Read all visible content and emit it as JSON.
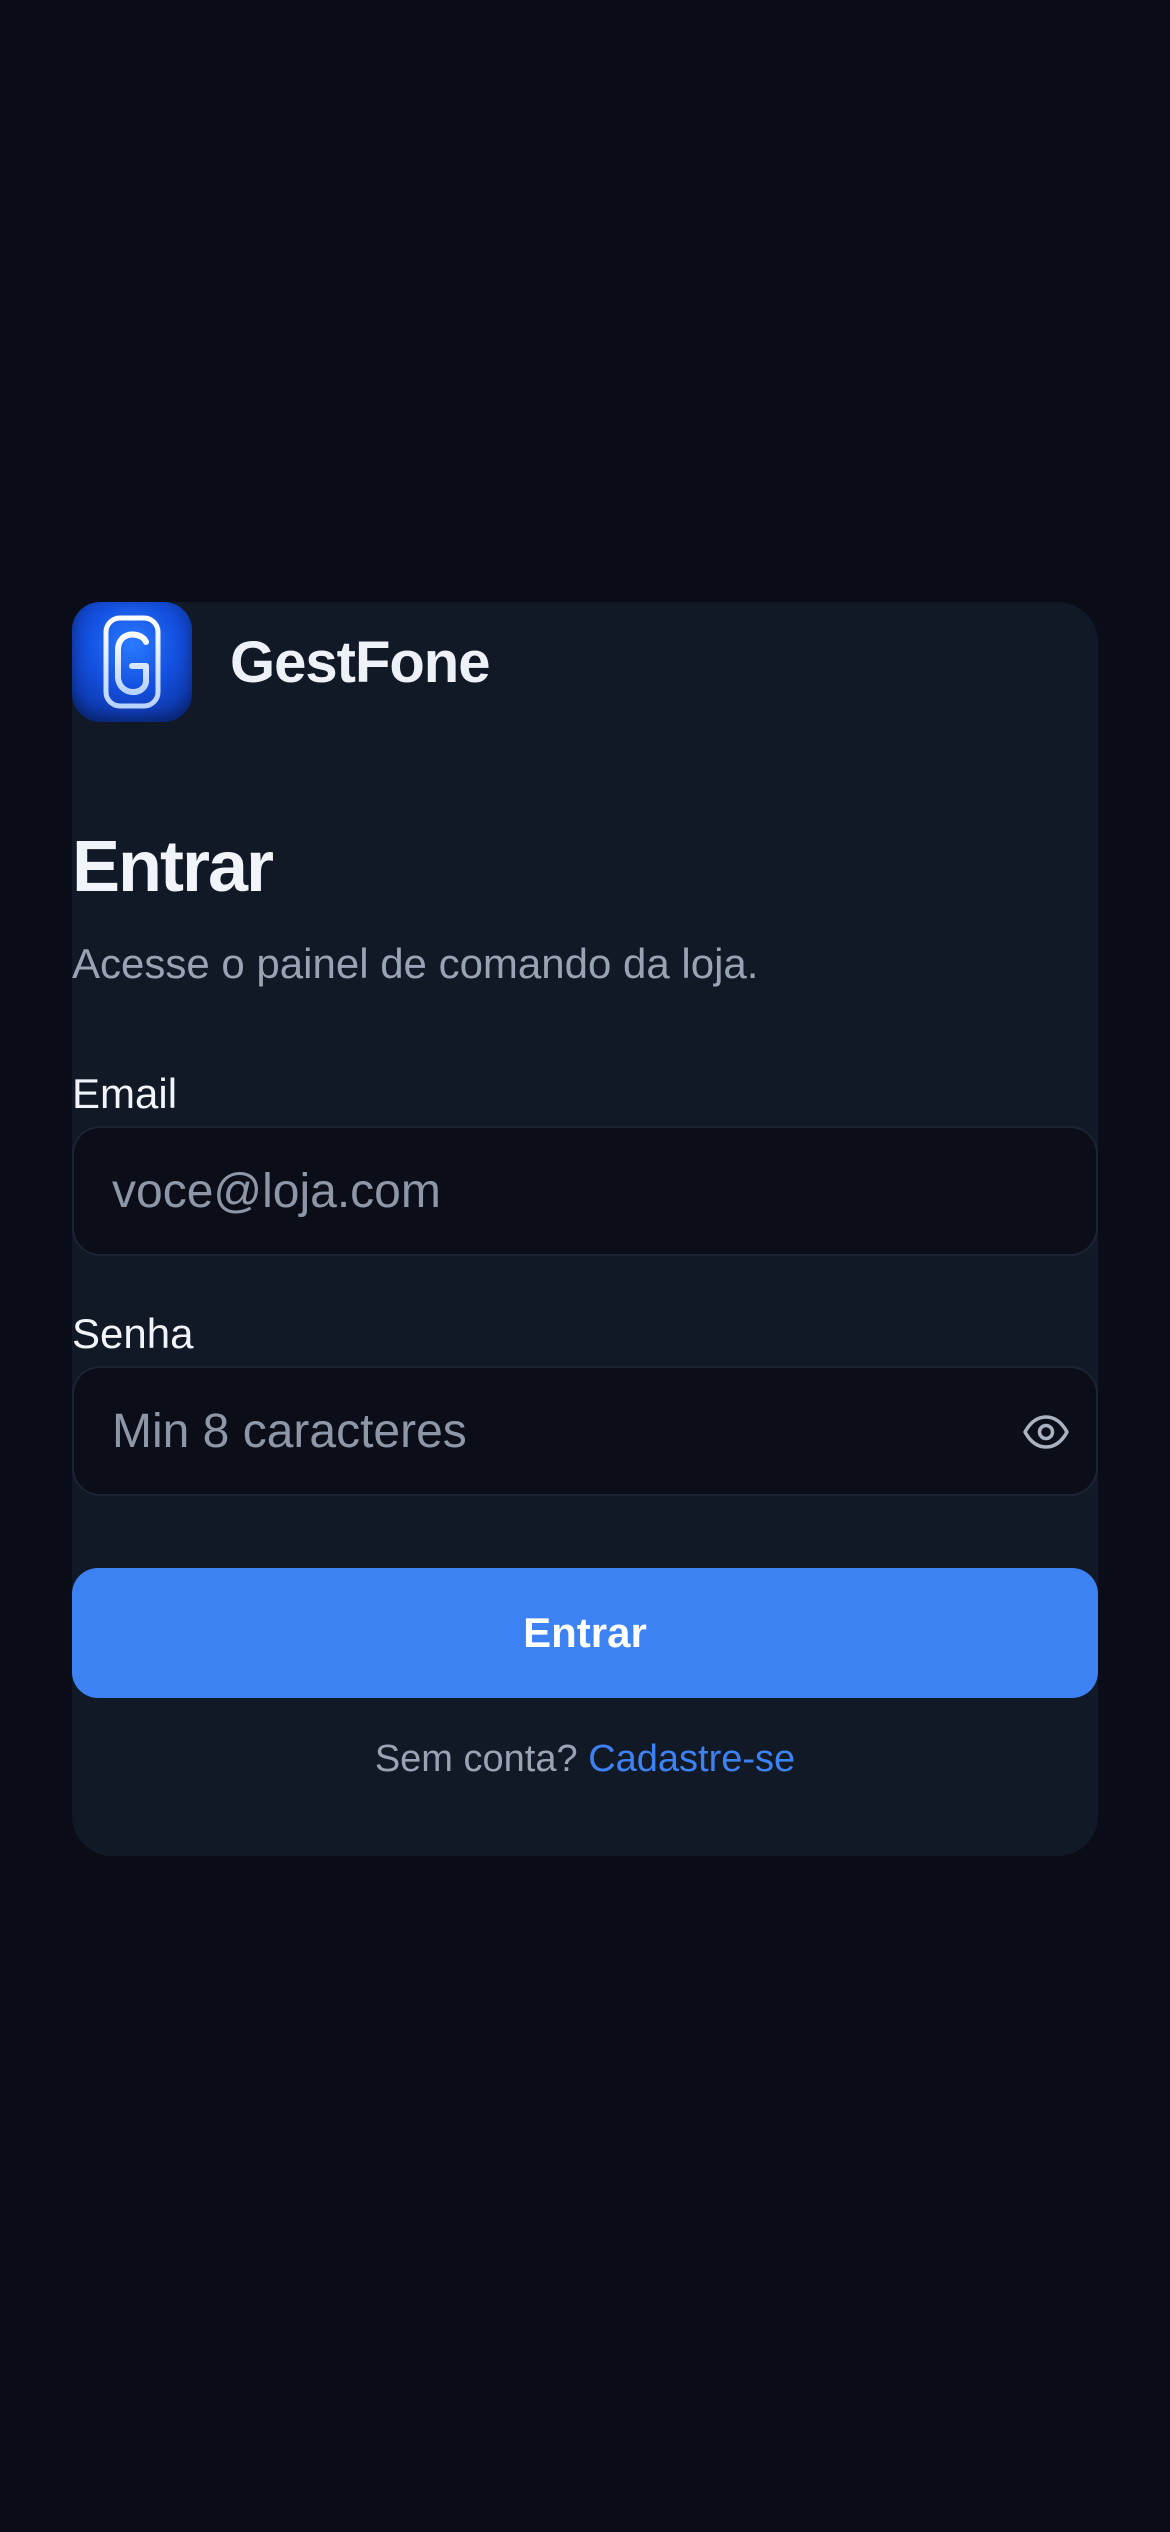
{
  "app": {
    "name": "GestFone",
    "logo_icon": "phone-g-logo-icon"
  },
  "login": {
    "title": "Entrar",
    "subtitle": "Acesse o painel de comando da loja.",
    "email": {
      "label": "Email",
      "placeholder": "voce@loja.com",
      "value": ""
    },
    "password": {
      "label": "Senha",
      "placeholder": "Min 8 caracteres",
      "value": "",
      "toggle_icon": "eye-icon"
    },
    "submit_label": "Entrar",
    "signup_prompt": "Sem conta?",
    "signup_link": "Cadastre-se"
  },
  "colors": {
    "background": "#0a0d17",
    "card": "#111826",
    "accent": "#3d82f3",
    "text_primary": "#f1f4f9",
    "text_muted": "#9aa3b4"
  }
}
